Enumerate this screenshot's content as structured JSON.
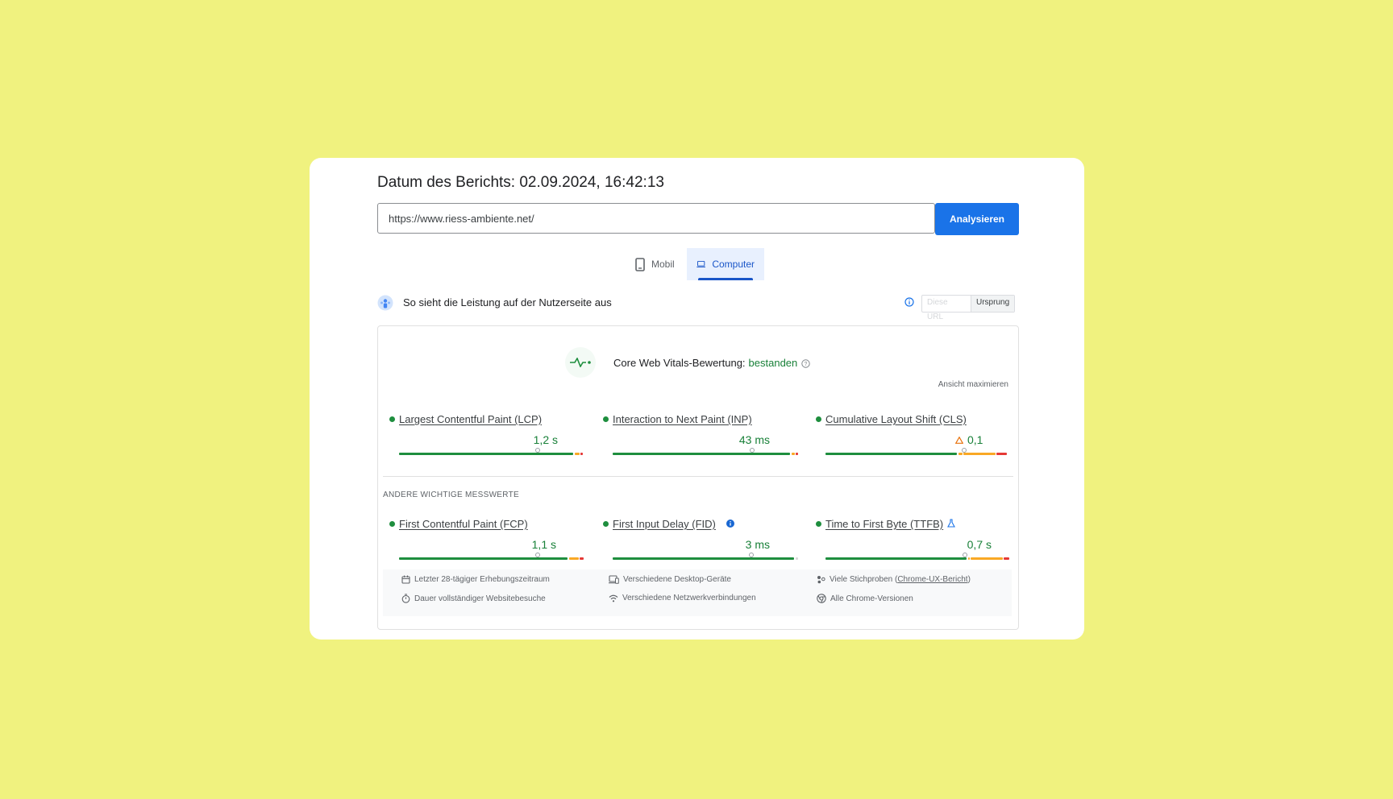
{
  "report": {
    "title": "Datum des Berichts: 02.09.2024, 16:42:13"
  },
  "search": {
    "url": "https://www.riess-ambiente.net/",
    "button": "Analysieren"
  },
  "tabs": [
    {
      "label": "Mobil",
      "icon": "phone-icon",
      "active": false
    },
    {
      "label": "Computer",
      "icon": "laptop-icon",
      "active": true
    }
  ],
  "field": {
    "title": "So sieht die Leistung auf der Nutzerseite aus",
    "toggle_url": "Diese URL",
    "toggle_origin": "Ursprung"
  },
  "cwv": {
    "label": "Core Web Vitals-Bewertung:",
    "status": "bestanden",
    "maximize": "Ansicht maximieren"
  },
  "core_metrics": [
    {
      "name": "Largest Contentful Paint (LCP)",
      "value": "1,2 s"
    },
    {
      "name": "Interaction to Next Paint (INP)",
      "value": "43 ms"
    },
    {
      "name": "Cumulative Layout Shift (CLS)",
      "value": "0,1"
    }
  ],
  "other_label": "ANDERE WICHTIGE MESSWERTE",
  "other_metrics": [
    {
      "name": "First Contentful Paint (FCP)",
      "value": "1,1 s"
    },
    {
      "name": "First Input Delay (FID)",
      "value": "3 ms"
    },
    {
      "name": "Time to First Byte (TTFB)",
      "value": "0,7 s"
    }
  ],
  "footer": {
    "period": "Letzter 28-tägiger Erhebungszeitraum",
    "visits": "Dauer vollständiger Websitebesuche",
    "devices": "Verschiedene Desktop-Geräte",
    "network": "Verschiedene Netzwerkverbindungen",
    "samples_prefix": "Viele Stichproben (",
    "samples_link": "Chrome-UX-Bericht",
    "samples_suffix": ")",
    "versions": "Alle Chrome-Versionen"
  },
  "colors": {
    "good": "#1e8e3e",
    "needs_improvement": "#f9a825",
    "poor": "#e53935",
    "accent": "#1a73e8",
    "background": "#f0f27f"
  }
}
